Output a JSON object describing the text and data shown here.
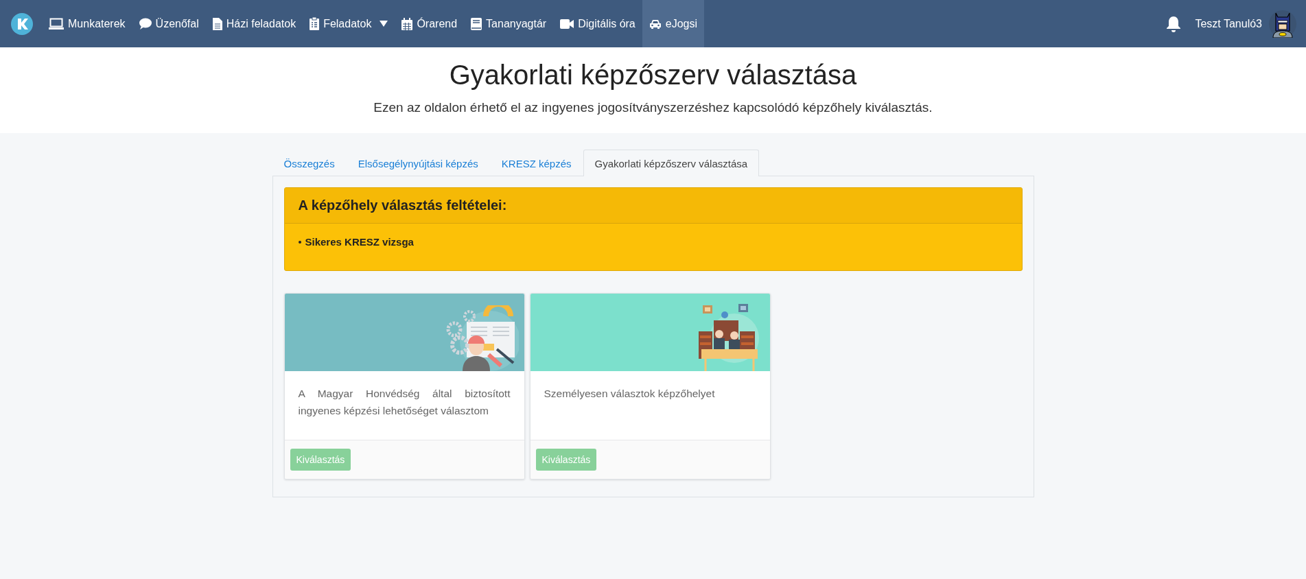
{
  "navbar": {
    "items": [
      {
        "label": "Munkaterek",
        "selected": false,
        "dropdown": false
      },
      {
        "label": "Üzenőfal",
        "selected": false,
        "dropdown": false
      },
      {
        "label": "Házi feladatok",
        "selected": false,
        "dropdown": false
      },
      {
        "label": "Feladatok",
        "selected": false,
        "dropdown": true
      },
      {
        "label": "Órarend",
        "selected": false,
        "dropdown": false
      },
      {
        "label": "Tananyagtár",
        "selected": false,
        "dropdown": false
      },
      {
        "label": "Digitális óra",
        "selected": false,
        "dropdown": false
      },
      {
        "label": "eJogsi",
        "selected": true,
        "dropdown": false
      }
    ],
    "user": "Teszt Tanuló3"
  },
  "header": {
    "title": "Gyakorlati képzőszerv választása",
    "subtitle": "Ezen az oldalon érhető el az ingyenes jogosítványszerzéshez kapcsolódó képzőhely kiválasztás."
  },
  "tabs": [
    {
      "label": "Összegzés",
      "selected": false
    },
    {
      "label": "Elsősegélynyújtási képzés",
      "selected": false
    },
    {
      "label": "KRESZ képzés",
      "selected": false
    },
    {
      "label": "Gyakorlati képzőszerv választása",
      "selected": true
    }
  ],
  "alert": {
    "title": "A képzőhely választás feltételei:",
    "items": [
      "Sikeres KRESZ vizsga"
    ]
  },
  "cards": [
    {
      "text": "A Magyar Honvédség által biztosított ingyenes képzési lehetőséget választom",
      "button": "Kiválasztás"
    },
    {
      "text": "Személyesen választok képzőhelyet",
      "button": "Kiválasztás"
    }
  ]
}
